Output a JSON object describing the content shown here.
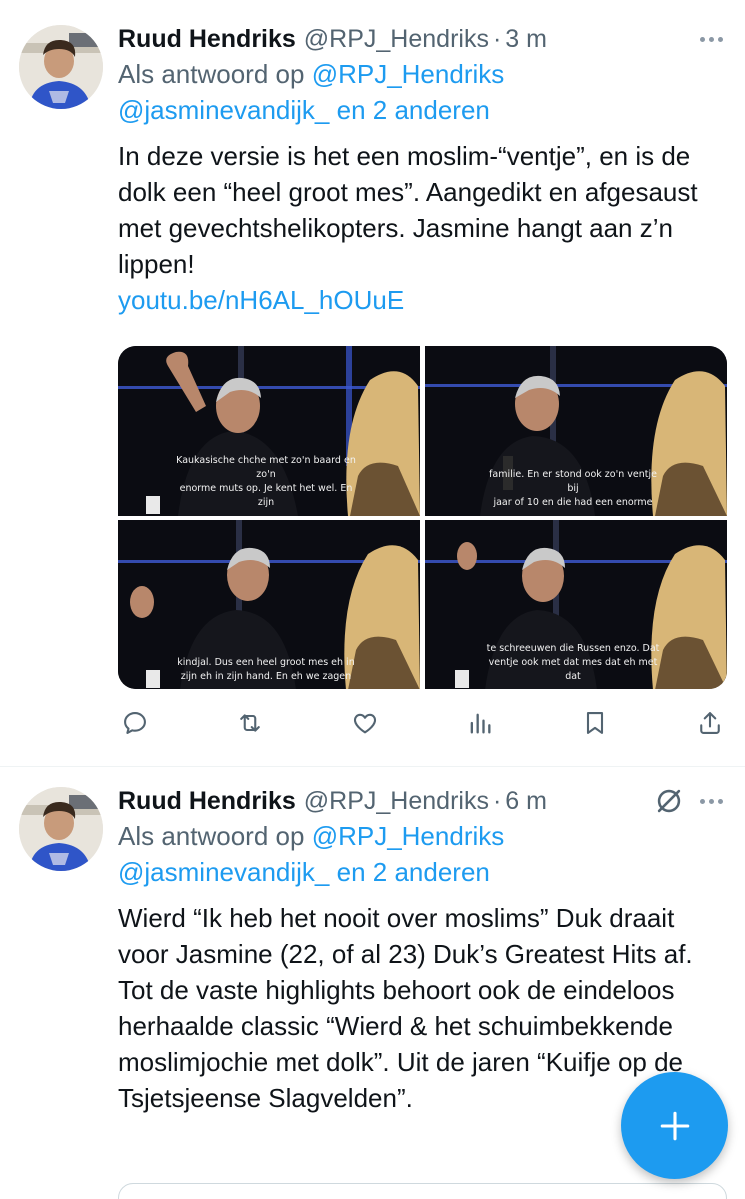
{
  "tweets": [
    {
      "author": {
        "name": "Ruud Hendriks",
        "handle": "@RPJ_Hendriks",
        "time": "3 m"
      },
      "reply": {
        "prefix": "Als antwoord op",
        "target": "@RPJ_Hendriks",
        "others_handle": "@jasminevandijk_",
        "others_suffix": "en 2 anderen"
      },
      "text": "In deze versie is het een moslim-“ventje”, en is de dolk een “heel groot mes”. Aangedikt en afgesaust met gevechtshelikopters. Jasmine hangt aan z’n lippen!",
      "link": "youtu.be/nH6AL_hOUuE",
      "media": [
        {
          "subtitle_line1": "Kaukasische chche met zo'n baard en zo'n",
          "subtitle_line2": "enorme muts op. Je kent het wel. En zijn"
        },
        {
          "subtitle_line1": "familie. En er stond ook zo'n ventje bij",
          "subtitle_line2": "jaar of 10 en die had een enorme"
        },
        {
          "subtitle_line1": "kindjal. Dus een heel groot mes eh in",
          "subtitle_line2": "zijn eh in zijn hand. En eh we zagen"
        },
        {
          "subtitle_line1": "te schreeuwen die Russen enzo. Dat",
          "subtitle_line2": "ventje ook met dat mes dat eh met dat"
        }
      ],
      "actions": [
        "reply-icon",
        "retweet-icon",
        "like-icon",
        "views-icon",
        "bookmark-icon",
        "share-icon"
      ]
    },
    {
      "author": {
        "name": "Ruud Hendriks",
        "handle": "@RPJ_Hendriks",
        "time": "6 m"
      },
      "reply": {
        "prefix": "Als antwoord op",
        "target": "@RPJ_Hendriks",
        "others_handle": "@jasminevandijk_",
        "others_suffix": "en 2 anderen"
      },
      "text": "Wierd “Ik heb het nooit over moslims” Duk draait voor Jasmine (22, of al 23) Duk’s Greatest Hits af. Tot de vaste highlights behoort ook de eindeloos herhaalde classic “Wierd & het schuimbekkende moslimjochie met dolk”. Uit de jaren “Kuifje op de Tsjetsjeense Slagvelden”."
    }
  ],
  "colors": {
    "accent": "#1d9bf0",
    "text": "#0f1419",
    "muted": "#536471"
  },
  "separator": "·",
  "fab": {
    "icon": "plus-icon"
  }
}
